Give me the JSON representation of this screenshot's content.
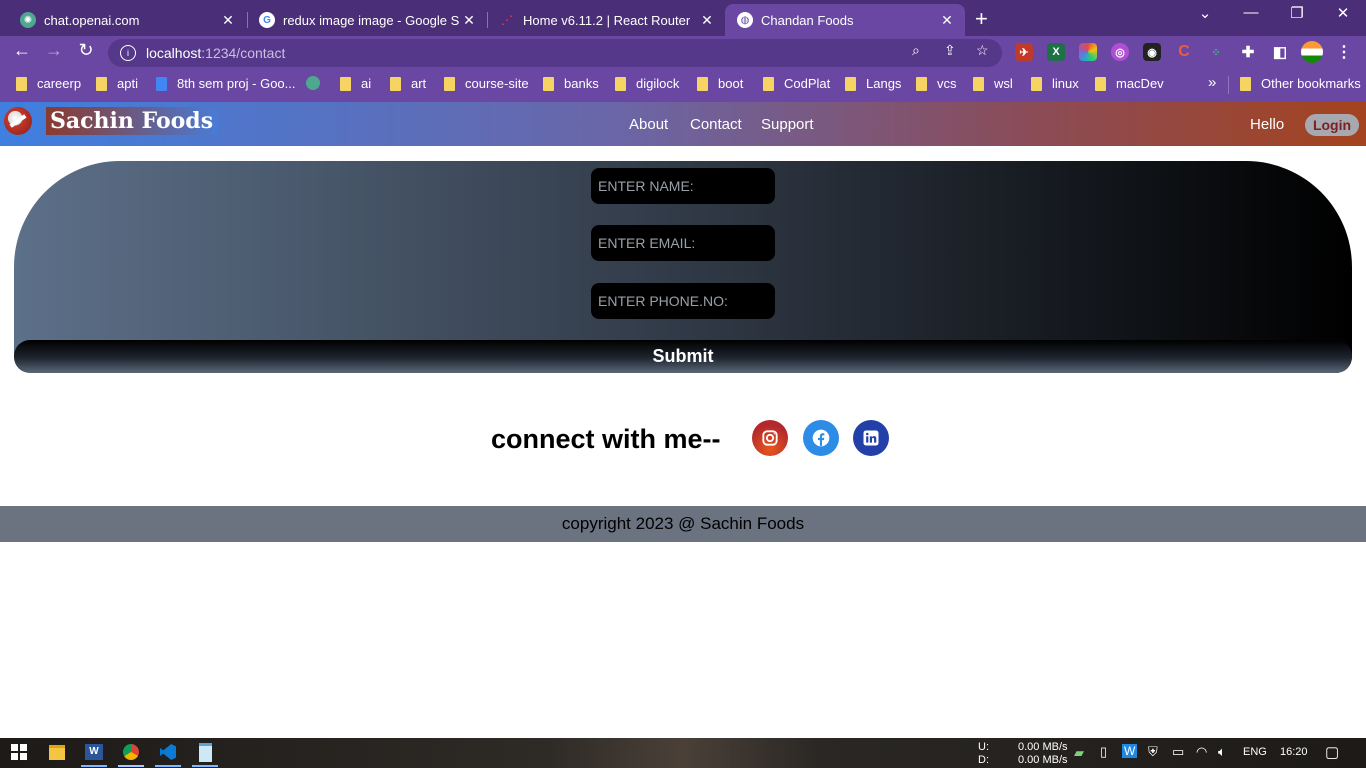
{
  "browser": {
    "tabs": [
      {
        "title": "chat.openai.com",
        "icon": "openai-icon",
        "active": false
      },
      {
        "title": "redux image image - Google Sea",
        "icon": "google-icon",
        "active": false
      },
      {
        "title": "Home v6.11.2 | React Router",
        "icon": "react-router-icon",
        "active": false
      },
      {
        "title": "Chandan Foods",
        "icon": "globe-icon",
        "active": true
      }
    ],
    "url_host": "localhost",
    "url_path": ":1234/contact",
    "bookmarks": [
      "careerp",
      "apti",
      "8th sem proj - Goo...",
      "ai",
      "art",
      "course-site",
      "banks",
      "digilock",
      "boot",
      "CodPlat",
      "Langs",
      "vcs",
      "wsl",
      "linux",
      "macDev"
    ],
    "other_bookmarks": "Other bookmarks",
    "overflow": "»"
  },
  "navbar": {
    "brand": "Sachin Foods",
    "links": [
      "About",
      "Contact",
      "Support"
    ],
    "greeting": "Hello",
    "login": "Login"
  },
  "form": {
    "name_placeholder": "ENTER NAME:",
    "email_placeholder": "ENTER EMAIL:",
    "phone_placeholder": "ENTER PHONE.NO:",
    "submit": "Submit"
  },
  "social": {
    "heading": "connect with me--",
    "icons": [
      "instagram-icon",
      "facebook-icon",
      "linkedin-icon"
    ],
    "colors": {
      "instagram": "#c0392b",
      "facebook": "#2d8ce6",
      "linkedin": "#233fa8"
    }
  },
  "footer": {
    "text": "copyright 2023 @ Sachin Foods"
  },
  "taskbar": {
    "net_up_label": "U:",
    "net_down_label": "D:",
    "net_up": "0.00 MB/s",
    "net_down": "0.00 MB/s",
    "lang": "ENG",
    "time": "16:20"
  }
}
